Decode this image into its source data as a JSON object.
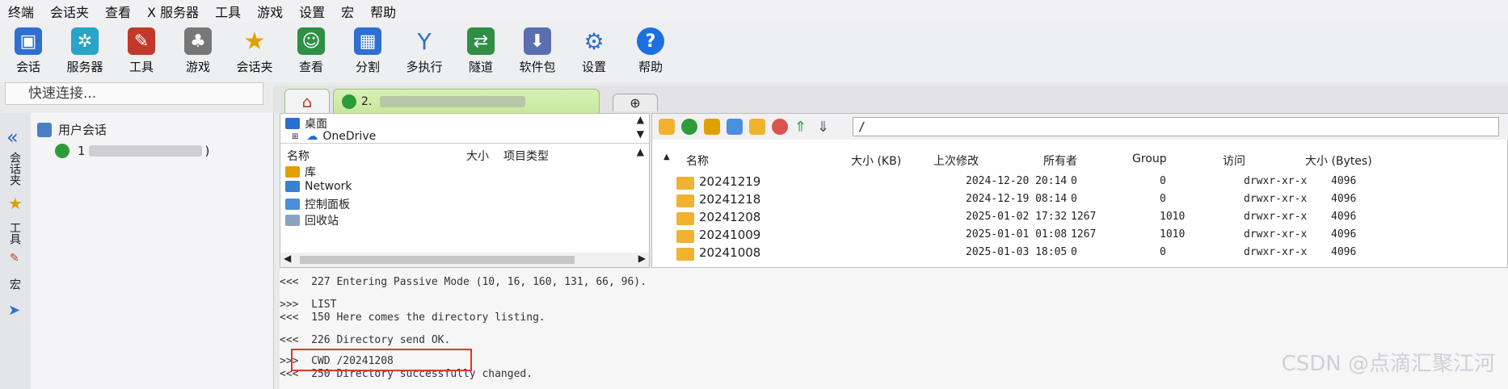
{
  "menu": [
    "终端",
    "会话夹",
    "查看",
    "X 服务器",
    "工具",
    "游戏",
    "设置",
    "宏",
    "帮助"
  ],
  "toolbar": [
    {
      "label": "会话",
      "icon": "session-icon",
      "color": "#2f6fd0"
    },
    {
      "label": "服务器",
      "icon": "servers-icon",
      "color": "#2aa3c8"
    },
    {
      "label": "工具",
      "icon": "tools-icon",
      "color": "#c0392b"
    },
    {
      "label": "游戏",
      "icon": "games-icon",
      "color": "#777777"
    },
    {
      "label": "会话夹",
      "icon": "star-icon",
      "color": "#e0a100"
    },
    {
      "label": "查看",
      "icon": "view-icon",
      "color": "#2f8f46"
    },
    {
      "label": "分割",
      "icon": "split-icon",
      "color": "#2f6fd0"
    },
    {
      "label": "多执行",
      "icon": "multiexec-icon",
      "color": "#2f6fd0"
    },
    {
      "label": "隧道",
      "icon": "tunnel-icon",
      "color": "#2f8f46"
    },
    {
      "label": "软件包",
      "icon": "packages-icon",
      "color": "#5a6fb0"
    },
    {
      "label": "设置",
      "icon": "settings-icon",
      "color": "#2f6fd0"
    },
    {
      "label": "帮助",
      "icon": "help-icon",
      "color": "#1f6fe0"
    }
  ],
  "quick_connect_placeholder": "快速连接...",
  "session_tab_prefix": "2.",
  "rail": {
    "sessions": "会话夹",
    "tools": "工具",
    "macros": "宏"
  },
  "sidebar": {
    "user_sessions": "用户会话",
    "session_prefix": "1",
    "session_suffix": ")"
  },
  "local": {
    "tree": [
      "桌面",
      "OneDrive"
    ],
    "headers": {
      "name": "名称",
      "size": "大小",
      "type": "项目类型"
    },
    "items": [
      "库",
      "Network",
      "控制面板",
      "回收站"
    ]
  },
  "remote": {
    "path": "/",
    "headers": {
      "name": "名称",
      "sizekb": "大小 (KB)",
      "modified": "上次修改",
      "owner": "所有者",
      "group": "Group",
      "access": "访问",
      "sizebytes": "大小 (Bytes)"
    },
    "rows": [
      {
        "name": "20241219",
        "modified": "2024-12-20 20:14",
        "owner": "0",
        "group": "0",
        "access": "drwxr-xr-x",
        "bytes": "4096"
      },
      {
        "name": "20241218",
        "modified": "2024-12-19 08:14",
        "owner": "0",
        "group": "0",
        "access": "drwxr-xr-x",
        "bytes": "4096"
      },
      {
        "name": "20241208",
        "modified": "2025-01-02 17:32",
        "owner": "1267",
        "group": "1010",
        "access": "drwxr-xr-x",
        "bytes": "4096"
      },
      {
        "name": "20241009",
        "modified": "2025-01-01 01:08",
        "owner": "1267",
        "group": "1010",
        "access": "drwxr-xr-x",
        "bytes": "4096"
      },
      {
        "name": "20241008",
        "modified": "2025-01-03 18:05",
        "owner": "0",
        "group": "0",
        "access": "drwxr-xr-x",
        "bytes": "4096"
      }
    ]
  },
  "log": [
    "<<<  227 Entering Passive Mode (10, 16, 160, 131, 66, 96).",
    ">>>  LIST",
    "<<<  150 Here comes the directory listing.",
    "<<<  226 Directory send OK.",
    ">>>  CWD /20241208",
    "<<<  250 Directory successfully changed."
  ],
  "watermark": "CSDN @点滴汇聚江河"
}
